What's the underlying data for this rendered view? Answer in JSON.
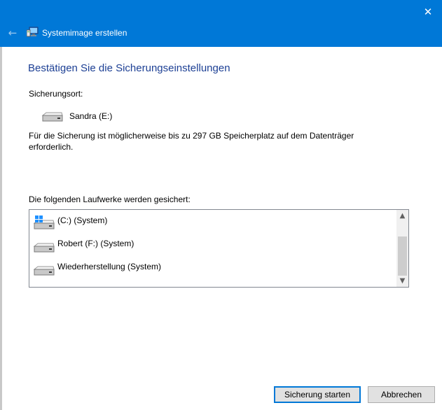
{
  "window": {
    "title": "Systemimage erstellen",
    "close_glyph": "✕",
    "back_glyph": "←",
    "icons": {
      "app": "backup-monitor-icon",
      "back": "back-arrow-icon",
      "close": "close-icon"
    }
  },
  "page": {
    "heading": "Bestätigen Sie die Sicherungseinstellungen",
    "location_label": "Sicherungsort:",
    "destination": {
      "name": "Sandra (E:)",
      "icon": "drive-icon"
    },
    "info_text": "Für die Sicherung ist möglicherweise bis zu 297 GB Speicherplatz auf dem Datenträger erforderlich.",
    "drives_label": "Die folgenden Laufwerke werden gesichert:",
    "drives": [
      {
        "name": "(C:) (System)",
        "icon": "windows-drive-icon"
      },
      {
        "name": "Robert (F:) (System)",
        "icon": "drive-icon"
      },
      {
        "name": "Wiederherstellung (System)",
        "icon": "drive-icon"
      }
    ],
    "scroll_up_glyph": "▲",
    "scroll_down_glyph": "▼"
  },
  "buttons": {
    "start": "Sicherung starten",
    "cancel": "Abbrechen"
  },
  "colors": {
    "titlebar": "#0078d7",
    "heading": "#1c3f94",
    "accent": "#0078d7"
  }
}
